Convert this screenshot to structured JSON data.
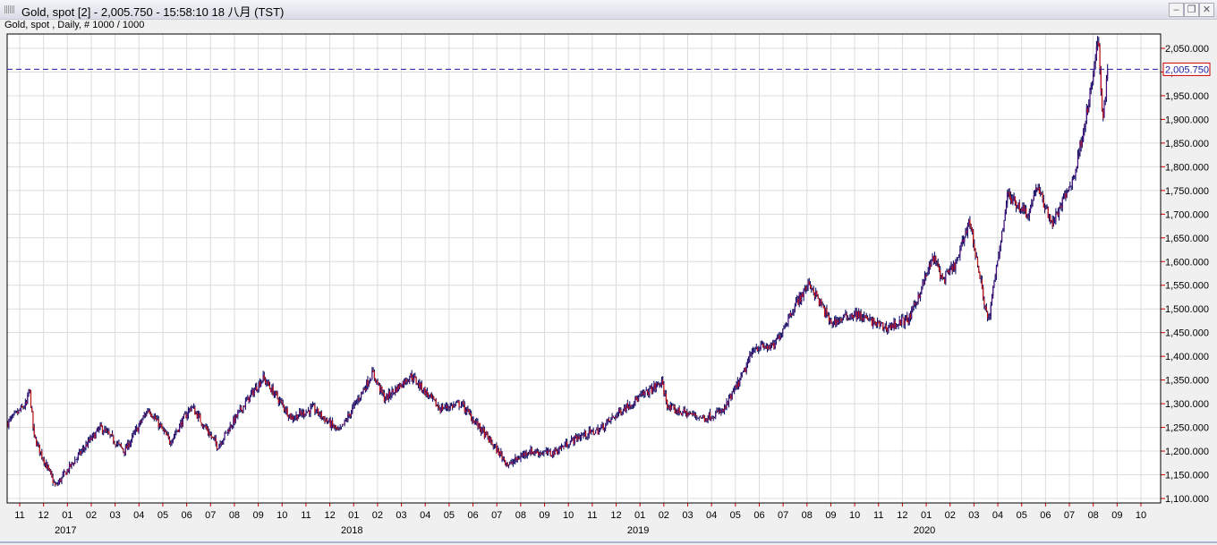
{
  "window": {
    "title": "Gold, spot [2] - 2,005.750 - 15:58:10  18 八月 (TST)",
    "subtitle": "Gold, spot , Daily, # 1000 / 1000",
    "minimize": "–",
    "restore": "❐",
    "close": "✕"
  },
  "chart_data": {
    "type": "candlestick",
    "title": "Gold, spot",
    "timeframe": "Daily",
    "current_price": 2005.75,
    "current_price_label": "2,005.750",
    "ylim": [
      1100,
      2075
    ],
    "y_ticks": [
      "1,100.000",
      "1,150.000",
      "1,200.000",
      "1,250.000",
      "1,300.000",
      "1,350.000",
      "1,400.000",
      "1,450.000",
      "1,500.000",
      "1,550.000",
      "1,600.000",
      "1,650.000",
      "1,700.000",
      "1,750.000",
      "1,800.000",
      "1,850.000",
      "1,900.000",
      "1,950.000",
      "2,000.000",
      "2,050.000"
    ],
    "x_ticks": [
      "11",
      "12",
      "01",
      "02",
      "03",
      "04",
      "05",
      "06",
      "07",
      "08",
      "09",
      "10",
      "11",
      "12",
      "01",
      "02",
      "03",
      "04",
      "05",
      "06",
      "07",
      "08",
      "09",
      "10",
      "11",
      "12",
      "01",
      "02",
      "03",
      "04",
      "05",
      "06",
      "07",
      "08",
      "09",
      "10",
      "11",
      "12",
      "01",
      "02",
      "03",
      "04",
      "05",
      "06",
      "07",
      "08",
      "09",
      "10"
    ],
    "x_years": [
      {
        "label": "2017",
        "month_index": 2
      },
      {
        "label": "2018",
        "month_index": 14
      },
      {
        "label": "2019",
        "month_index": 26
      },
      {
        "label": "2020",
        "month_index": 38
      }
    ],
    "series_keypoints_months_from_nov2016": [
      [
        -0.5,
        1260
      ],
      [
        0.3,
        1300
      ],
      [
        0.4,
        1335
      ],
      [
        0.6,
        1230
      ],
      [
        1.5,
        1125
      ],
      [
        2.0,
        1160
      ],
      [
        2.9,
        1220
      ],
      [
        3.4,
        1250
      ],
      [
        4.4,
        1200
      ],
      [
        5.4,
        1290
      ],
      [
        6.3,
        1220
      ],
      [
        7.2,
        1295
      ],
      [
        8.3,
        1210
      ],
      [
        9.3,
        1290
      ],
      [
        10.2,
        1355
      ],
      [
        11.4,
        1270
      ],
      [
        12.3,
        1290
      ],
      [
        13.4,
        1240
      ],
      [
        14.8,
        1365
      ],
      [
        15.3,
        1310
      ],
      [
        16.4,
        1360
      ],
      [
        17.6,
        1290
      ],
      [
        18.5,
        1300
      ],
      [
        20.5,
        1170
      ],
      [
        21.3,
        1200
      ],
      [
        22.3,
        1195
      ],
      [
        23.4,
        1230
      ],
      [
        24.3,
        1245
      ],
      [
        25.3,
        1290
      ],
      [
        26.9,
        1345
      ],
      [
        27.2,
        1290
      ],
      [
        28.7,
        1270
      ],
      [
        29.5,
        1285
      ],
      [
        30.3,
        1360
      ],
      [
        30.8,
        1420
      ],
      [
        31.6,
        1420
      ],
      [
        32.4,
        1500
      ],
      [
        33.1,
        1555
      ],
      [
        34.0,
        1470
      ],
      [
        35.0,
        1490
      ],
      [
        36.3,
        1460
      ],
      [
        37.3,
        1480
      ],
      [
        38.3,
        1610
      ],
      [
        38.7,
        1560
      ],
      [
        39.3,
        1600
      ],
      [
        39.8,
        1690
      ],
      [
        40.6,
        1470
      ],
      [
        41.4,
        1740
      ],
      [
        42.3,
        1700
      ],
      [
        42.6,
        1760
      ],
      [
        43.3,
        1680
      ],
      [
        44.2,
        1780
      ],
      [
        44.9,
        1960
      ],
      [
        45.2,
        2070
      ],
      [
        45.4,
        1900
      ],
      [
        45.6,
        2005.75
      ]
    ]
  }
}
